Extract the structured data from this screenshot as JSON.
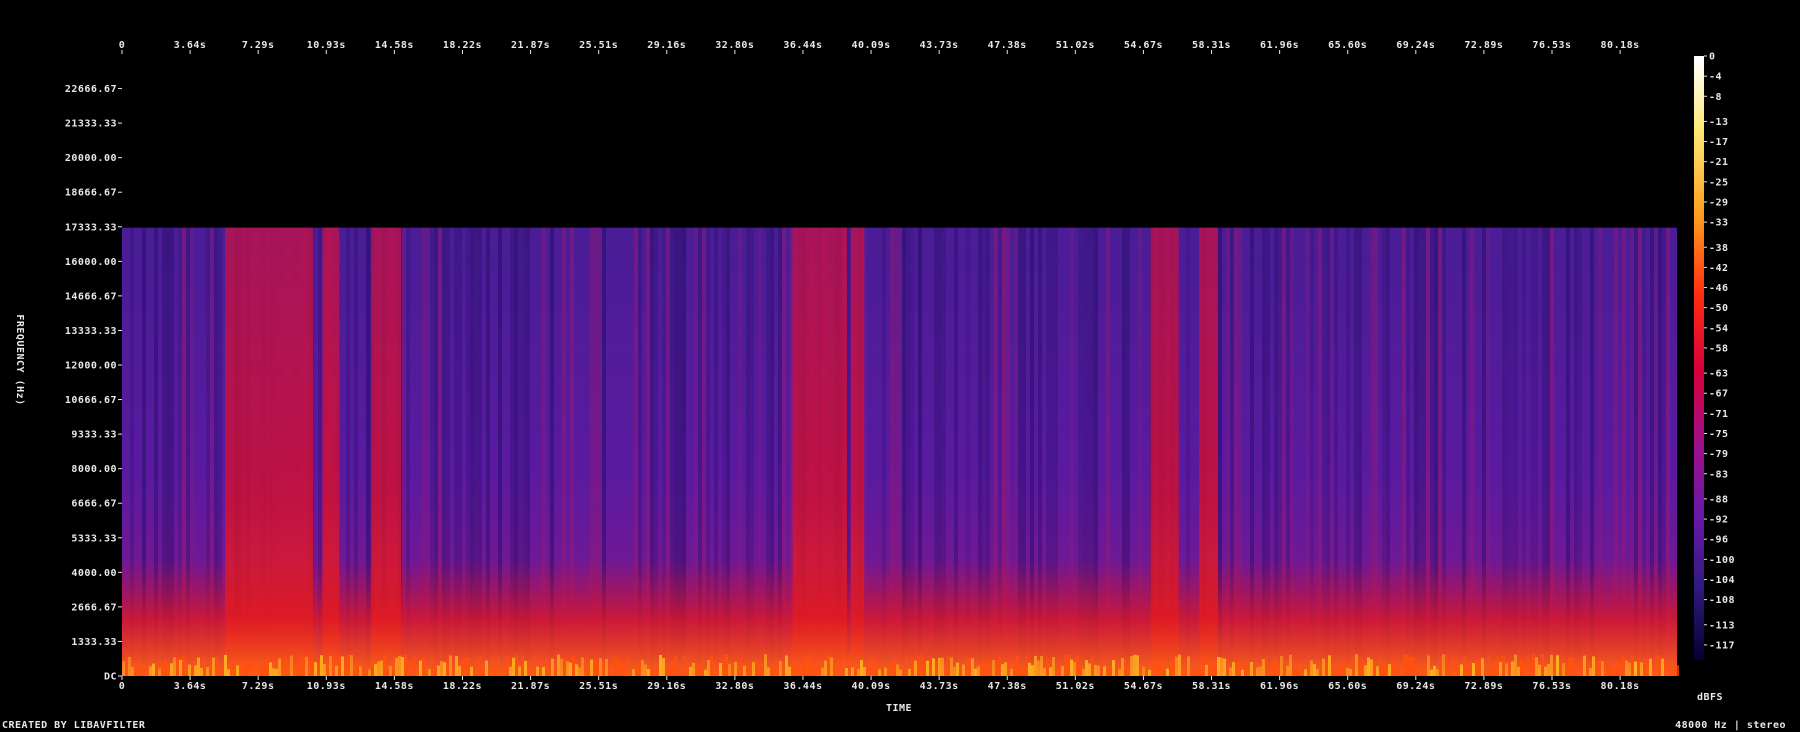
{
  "chart_data": {
    "type": "heatmap",
    "xlabel": "TIME",
    "ylabel": "FREQUENCY (Hz)",
    "x_ticks": [
      "0",
      "3.64s",
      "7.29s",
      "10.93s",
      "14.58s",
      "18.22s",
      "21.87s",
      "25.51s",
      "29.16s",
      "32.80s",
      "36.44s",
      "40.09s",
      "43.73s",
      "47.38s",
      "51.02s",
      "54.67s",
      "58.31s",
      "61.96s",
      "65.60s",
      "69.24s",
      "72.89s",
      "76.53s",
      "80.18s"
    ],
    "x_range": [
      0,
      83.0
    ],
    "y_ticks": [
      "DC",
      "1333.33",
      "2666.67",
      "4000.00",
      "5333.33",
      "6666.67",
      "8000.00",
      "9333.33",
      "10666.67",
      "12000.00",
      "13333.33",
      "14666.67",
      "16000.00",
      "17333.33",
      "18666.67",
      "20000.00",
      "21333.33",
      "22666.67"
    ],
    "y_range": [
      0,
      24000
    ],
    "bandwidth_cutoff_hz": 17300,
    "colorbar": {
      "unit": "dBFS",
      "ticks": [
        "0",
        "-4",
        "-8",
        "-13",
        "-17",
        "-21",
        "-25",
        "-29",
        "-33",
        "-38",
        "-42",
        "-46",
        "-50",
        "-54",
        "-58",
        "-63",
        "-67",
        "-71",
        "-75",
        "-79",
        "-83",
        "-88",
        "-92",
        "-96",
        "-100",
        "-104",
        "-108",
        "-113",
        "-117"
      ],
      "range": [
        0,
        -120
      ]
    },
    "loud_segments_s": [
      [
        5.5,
        10.2
      ],
      [
        10.7,
        11.6
      ],
      [
        13.3,
        14.9
      ],
      [
        35.8,
        38.7
      ],
      [
        38.9,
        39.6
      ],
      [
        54.9,
        56.4
      ],
      [
        57.5,
        58.5
      ]
    ]
  },
  "footer": {
    "credit": "CREATED BY LIBAVFILTER",
    "format": "48000 Hz | stereo"
  }
}
